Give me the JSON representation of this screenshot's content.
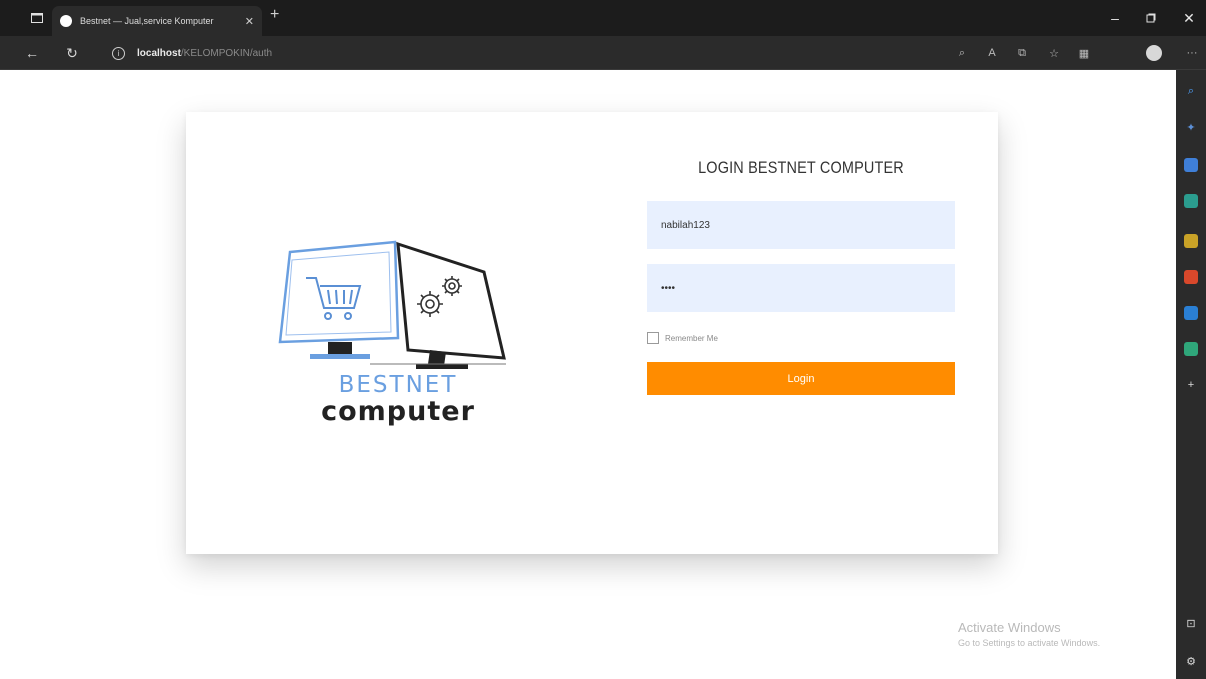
{
  "browser": {
    "tab_title": "Bestnet — Jual,service Komputer",
    "url_host": "localhost",
    "url_path": "/KELOMPOKIN/auth"
  },
  "login": {
    "title": "LOGIN BESTNET COMPUTER",
    "username_value": "nabilah123",
    "password_value": "1234",
    "remember_label": "Remember Me",
    "login_button": "Login"
  },
  "logo": {
    "line1": "BESTNET",
    "line2": "computer"
  },
  "watermark": {
    "title": "Activate Windows",
    "subtitle": "Go to Settings to activate Windows."
  },
  "colors": {
    "accent": "#ff8c00",
    "input_bg": "#e8f0fe",
    "logo_blue": "#6a9fe0",
    "logo_dark": "#222222"
  }
}
